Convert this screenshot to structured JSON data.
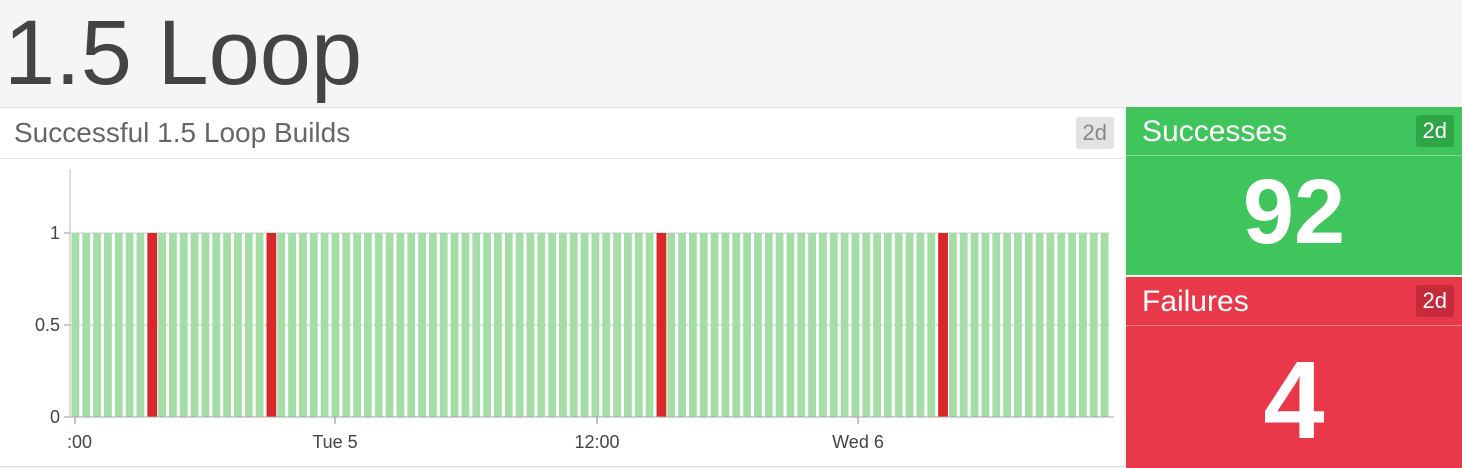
{
  "page": {
    "title": "1.5 Loop"
  },
  "chart_panel": {
    "title": "Successful 1.5 Loop Builds",
    "range_badge": "2d"
  },
  "chart_data": {
    "type": "bar",
    "title": "Successful 1.5 Loop Builds",
    "xlabel": "",
    "ylabel": "",
    "ylim": [
      0,
      1
    ],
    "y_ticks": [
      "0",
      "0.5",
      "1"
    ],
    "x_ticks": [
      ":00",
      "Tue 5",
      "12:00",
      "Wed 6"
    ],
    "grid": true,
    "bar_count": 96,
    "values": [
      1,
      1,
      1,
      1,
      1,
      1,
      1,
      1,
      1,
      1,
      1,
      1,
      1,
      1,
      1,
      1,
      1,
      1,
      1,
      1,
      1,
      1,
      1,
      1,
      1,
      1,
      1,
      1,
      1,
      1,
      1,
      1,
      1,
      1,
      1,
      1,
      1,
      1,
      1,
      1,
      1,
      1,
      1,
      1,
      1,
      1,
      1,
      1,
      1,
      1,
      1,
      1,
      1,
      1,
      1,
      1,
      1,
      1,
      1,
      1,
      1,
      1,
      1,
      1,
      1,
      1,
      1,
      1,
      1,
      1,
      1,
      1,
      1,
      1,
      1,
      1,
      1,
      1,
      1,
      1,
      1,
      1,
      1,
      1,
      1,
      1,
      1,
      1,
      1,
      1,
      1,
      1,
      1,
      1,
      1,
      1
    ],
    "status": [
      "s",
      "s",
      "s",
      "s",
      "s",
      "s",
      "s",
      "f",
      "s",
      "s",
      "s",
      "s",
      "s",
      "s",
      "s",
      "s",
      "s",
      "s",
      "f",
      "s",
      "s",
      "s",
      "s",
      "s",
      "s",
      "s",
      "s",
      "s",
      "s",
      "s",
      "s",
      "s",
      "s",
      "s",
      "s",
      "s",
      "s",
      "s",
      "s",
      "s",
      "s",
      "s",
      "s",
      "s",
      "s",
      "s",
      "s",
      "s",
      "s",
      "s",
      "s",
      "s",
      "s",
      "s",
      "f",
      "s",
      "s",
      "s",
      "s",
      "s",
      "s",
      "s",
      "s",
      "s",
      "s",
      "s",
      "s",
      "s",
      "s",
      "s",
      "s",
      "s",
      "s",
      "s",
      "s",
      "s",
      "s",
      "s",
      "s",
      "s",
      "f",
      "s",
      "s",
      "s",
      "s",
      "s",
      "s",
      "s",
      "s",
      "s",
      "s",
      "s",
      "s",
      "s",
      "s",
      "s"
    ],
    "colors": {
      "success": "#a4dea6",
      "failure": "#d8282a"
    }
  },
  "successes": {
    "label": "Successes",
    "range_badge": "2d",
    "value": "92",
    "color": "#3fc55c"
  },
  "failures": {
    "label": "Failures",
    "range_badge": "2d",
    "value": "4",
    "color": "#e8384a"
  }
}
